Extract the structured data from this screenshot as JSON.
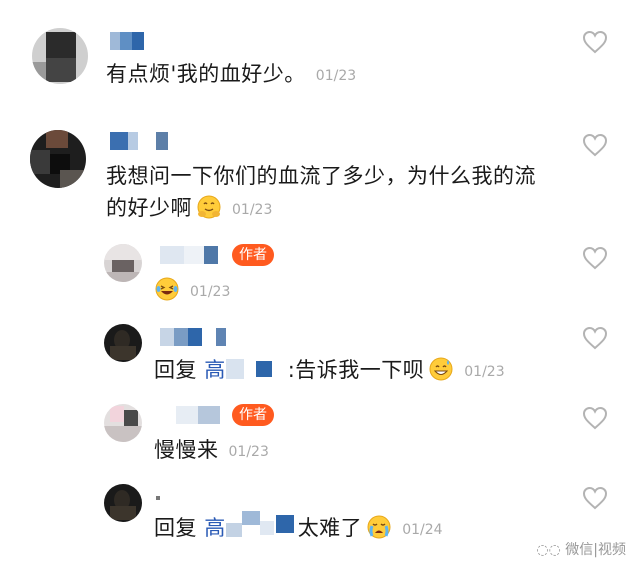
{
  "comments": [
    {
      "text": "有点烦'我的血好少。",
      "date": "01/23",
      "badge": ""
    },
    {
      "text": "我想问一下你们的血流了多少，为什么我的流的好少啊",
      "date": "01/23",
      "emoji": "hug-emoji",
      "badge": ""
    },
    {
      "text": "",
      "date": "01/23",
      "emoji": "laugh-emoji",
      "badge": "作者"
    },
    {
      "reply_prefix": "回复",
      "mention": "高",
      "text": ":告诉我一下呗",
      "date": "01/23",
      "emoji": "sweat-smile-emoji",
      "badge": ""
    },
    {
      "text": "慢慢来",
      "date": "01/23",
      "badge": "作者"
    },
    {
      "reply_prefix": "回复",
      "mention": "高",
      "text": "太难了",
      "date": "01/24",
      "emoji": "crying-emoji",
      "badge": ""
    }
  ],
  "watermark": "微信|视频",
  "colors": {
    "accent_badge": "#ff5a1f",
    "mention": "#2a5ab5",
    "date": "#a9a9a9",
    "heart_outline": "#b3b3b3"
  },
  "icons": {
    "like": "heart-outline-icon"
  }
}
